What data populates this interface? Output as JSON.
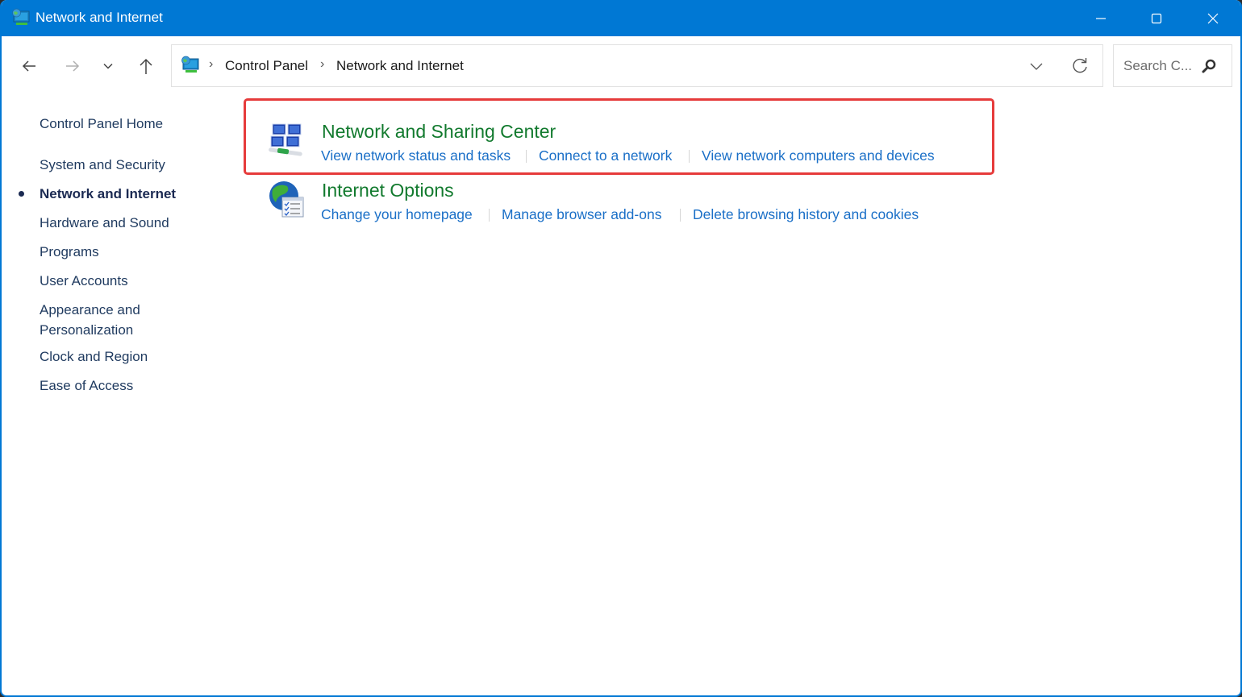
{
  "window": {
    "title": "Network and Internet",
    "controls": {
      "minimize": "minimize",
      "maximize": "maximize",
      "close": "close"
    },
    "accent_color": "#0078d4"
  },
  "navigation": {
    "back": "Back",
    "forward": "Forward",
    "recent": "Recent locations",
    "up": "Up"
  },
  "address_bar": {
    "breadcrumbs": [
      "Control Panel",
      "Network and Internet"
    ],
    "separator": "›"
  },
  "search": {
    "placeholder": "Search C...",
    "value": ""
  },
  "sidebar": {
    "home": "Control Panel Home",
    "items": [
      {
        "label": "System and Security",
        "active": false
      },
      {
        "label": "Network and Internet",
        "active": true
      },
      {
        "label": "Hardware and Sound",
        "active": false
      },
      {
        "label": "Programs",
        "active": false
      },
      {
        "label": "User Accounts",
        "active": false
      },
      {
        "label": "Appearance and",
        "label2": "Personalization",
        "active": false
      },
      {
        "label": "Clock and Region",
        "active": false
      },
      {
        "label": "Ease of Access",
        "active": false
      }
    ]
  },
  "categories": [
    {
      "title": "Network and Sharing Center",
      "icon": "network-sharing-icon",
      "highlighted": true,
      "links": [
        "View network status and tasks",
        "Connect to a network",
        "View network computers and devices"
      ]
    },
    {
      "title": "Internet Options",
      "icon": "internet-options-icon",
      "highlighted": false,
      "links": [
        "Change your homepage",
        "Manage browser add-ons",
        "Delete browsing history and cookies"
      ]
    }
  ],
  "colors": {
    "category_title": "#127a2e",
    "link": "#1a6fc7",
    "highlight_border": "#e63b3b"
  }
}
